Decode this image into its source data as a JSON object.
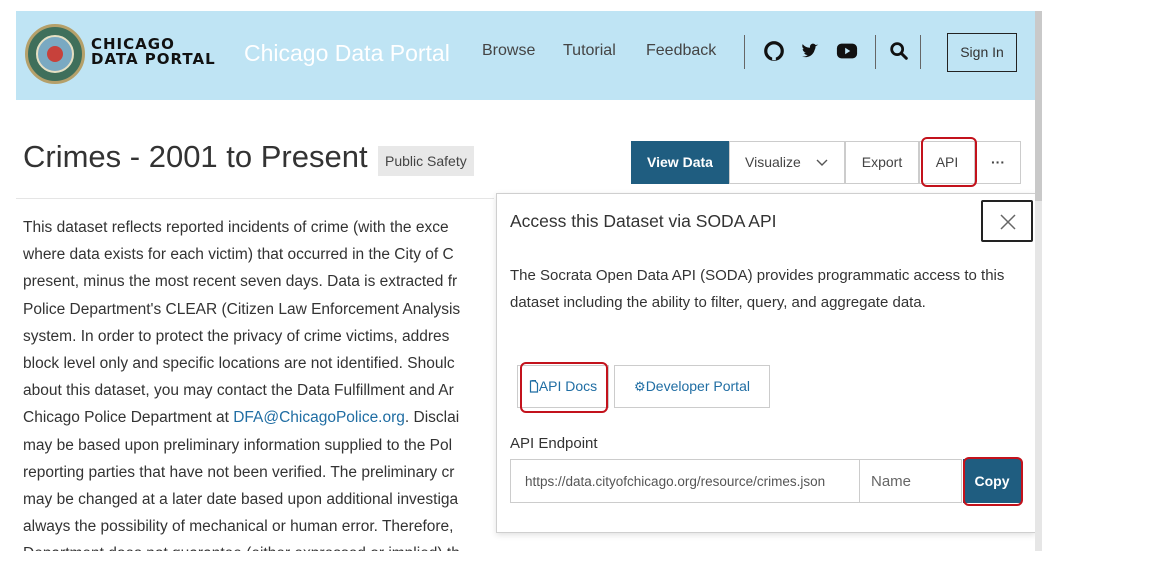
{
  "header": {
    "brand_line1": "CHICAGO",
    "brand_line2": "DATA PORTAL",
    "portal_title": "Chicago Data Portal",
    "nav": [
      "Browse",
      "Tutorial",
      "Feedback"
    ],
    "icons": [
      "github-icon",
      "twitter-icon",
      "youtube-icon",
      "search-icon"
    ],
    "sign_in": "Sign In",
    "bg_color": "#bfe4f4"
  },
  "dataset": {
    "title": "Crimes - 2001 to Present",
    "category": "Public Safety"
  },
  "toolbar": {
    "view_data": "View Data",
    "visualize": "Visualize",
    "export": "Export",
    "api": "API",
    "more": "···"
  },
  "description": {
    "lines": [
      "This dataset reflects reported incidents of crime (with the exce",
      "where data exists for each victim) that occurred in the City of C",
      "present, minus the most recent seven days. Data is extracted fr",
      "Police Department's CLEAR (Citizen Law Enforcement Analysis",
      "system. In order to protect the privacy of crime victims, addres",
      "block level only and specific locations are not identified. Shoulc",
      "about this dataset, you may contact the Data Fulfillment and Ar"
    ],
    "line8_prefix": "Chicago Police Department at ",
    "email": "DFA@ChicagoPolice.org",
    "line8_suffix": ". Disclai",
    "lines_after": [
      "may be based upon preliminary information supplied to the Pol",
      "reporting parties that have not been verified. The preliminary cr",
      "may be changed at a later date based upon additional investiga",
      "always the possibility of mechanical or human error. Therefore,",
      "Department does not guarantee (either expressed or implied) th"
    ]
  },
  "api_panel": {
    "title": "Access this Dataset via SODA API",
    "description": "The Socrata Open Data API (SODA) provides programmatic access to this dataset including the ability to filter, query, and aggregate data.",
    "api_docs": "API Docs",
    "developer_portal": "Developer Portal",
    "endpoint_label": "API Endpoint",
    "endpoint_value": "https://data.cityofchicago.org/resource/crimes.json",
    "name_placeholder": "Name",
    "copy": "Copy"
  },
  "colors": {
    "primary": "#1f5d80",
    "link": "#1f6da3",
    "highlight": "#c3121c"
  }
}
